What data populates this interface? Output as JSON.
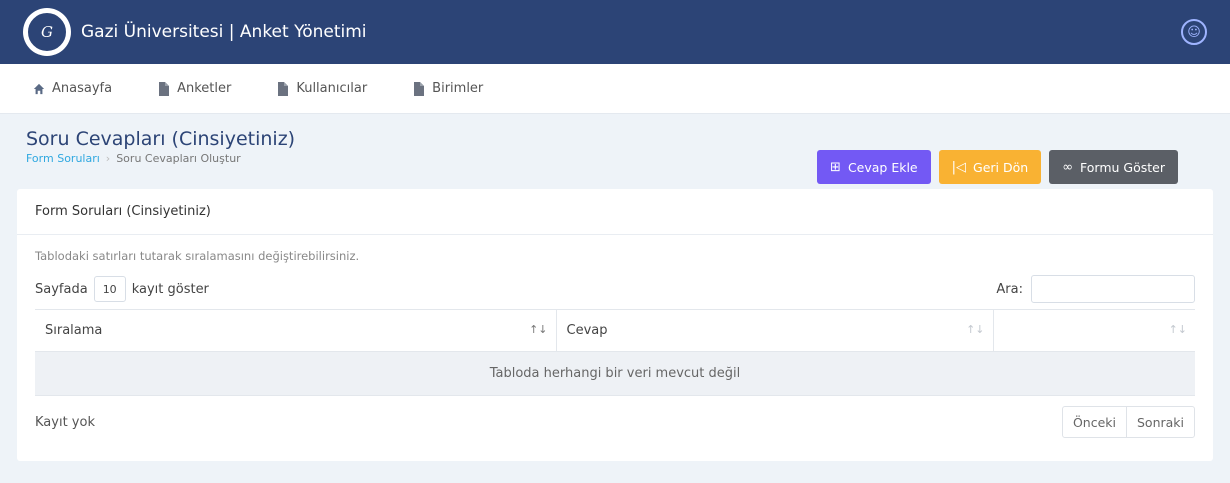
{
  "header": {
    "app_title": "Gazi Üniversitesi | Anket Yönetimi",
    "logo_text": "Gazi"
  },
  "nav": {
    "items": [
      {
        "label": "Anasayfa",
        "icon": "home-icon"
      },
      {
        "label": "Anketler",
        "icon": "file-icon"
      },
      {
        "label": "Kullanıcılar",
        "icon": "file-icon"
      },
      {
        "label": "Birimler",
        "icon": "file-icon"
      }
    ]
  },
  "page": {
    "title": "Soru Cevapları (Cinsiyetiniz)",
    "breadcrumb": [
      {
        "label": "Form Soruları"
      },
      {
        "label": "Soru Cevapları Oluştur"
      }
    ]
  },
  "actions": {
    "add_label": "Cevap Ekle",
    "back_label": "Geri Dön",
    "show_form_label": "Formu Göster",
    "colors": {
      "add": "#7359f4",
      "back": "#f9b233",
      "show": "#5b5f66"
    }
  },
  "card": {
    "title": "Form Soruları (Cinsiyetiniz)",
    "hint": "Tablodaki satırları tutarak sıralamasını değiştirebilirsiniz.",
    "length_prefix": "Sayfada",
    "length_value": "10",
    "length_suffix": "kayıt göster",
    "search_label": "Ara:",
    "search_value": "",
    "columns": [
      "Sıralama",
      "Cevap",
      ""
    ],
    "empty_message": "Tabloda herhangi bir veri mevcut değil",
    "info": "Kayıt yok",
    "prev_label": "Önceki",
    "next_label": "Sonraki"
  }
}
